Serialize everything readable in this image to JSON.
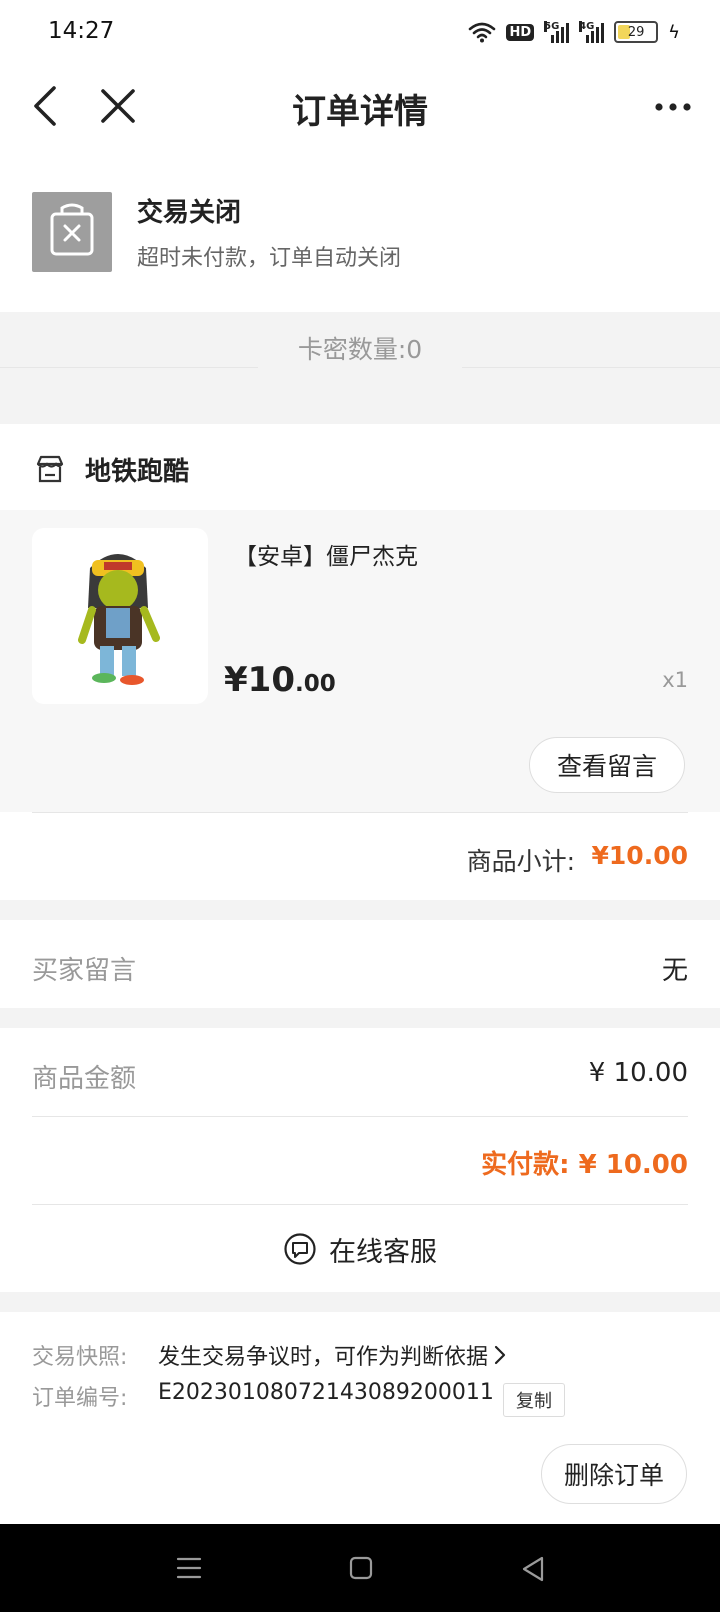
{
  "status_bar": {
    "time": "14:27",
    "wifi_icon": "wifi-icon",
    "hd_badge": "HD",
    "signal1_label": "5G",
    "signal2_label": "4G",
    "battery_level": "29",
    "charging_icon": "bolt-icon"
  },
  "nav": {
    "title": "订单详情",
    "back_icon": "chevron-left-icon",
    "close_icon": "close-icon",
    "more_icon": "more-dots-icon"
  },
  "order_status": {
    "title": "交易关闭",
    "subtitle": "超时未付款，订单自动关闭",
    "icon": "closed-bag-icon"
  },
  "card_count": "卡密数量:0",
  "shop": {
    "name": "地铁跑酷",
    "icon": "store-icon"
  },
  "product": {
    "name": "【安卓】僵尸杰克",
    "price_int": "¥10",
    "price_dec": ".00",
    "quantity": "x1",
    "view_message_button": "查看留言",
    "image_icon": "zombie-jake-figure"
  },
  "subtotal": {
    "label": "商品小计:",
    "value": "¥10.00"
  },
  "buyer_message": {
    "label": "买家留言",
    "value": "无"
  },
  "amounts": {
    "goods_label": "商品金额",
    "goods_value": "¥ 10.00",
    "paid_label": "实付款: ¥ 10.00"
  },
  "customer_service": {
    "label": "在线客服",
    "icon": "chat-bubble-icon"
  },
  "info": {
    "snapshot_label": "交易快照:",
    "snapshot_value": "发生交易争议时，可作为判断依据",
    "order_no_label": "订单编号:",
    "order_no_value": "E20230108072143089200011",
    "copy_button": "复制"
  },
  "actions": {
    "delete_button": "删除订单"
  },
  "colors": {
    "accent": "#ee6a1e",
    "muted": "#999999",
    "background": "#f3f3f3"
  },
  "system_nav": {
    "menu_icon": "menu-icon",
    "home_icon": "home-square-icon",
    "back_icon": "triangle-back-icon"
  }
}
